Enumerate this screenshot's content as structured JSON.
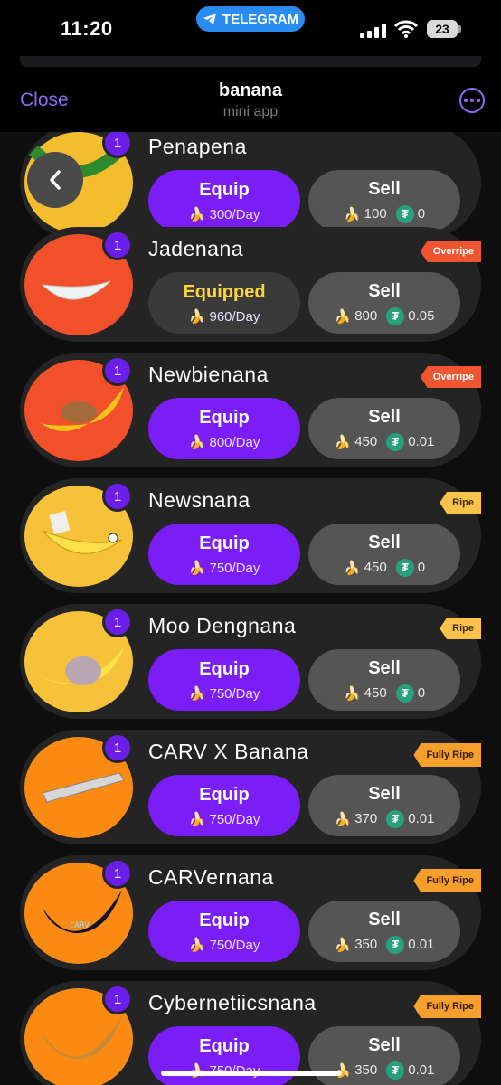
{
  "status": {
    "time": "11:20",
    "pill": "TELEGRAM",
    "battery": "23"
  },
  "header": {
    "close": "Close",
    "title": "banana",
    "subtitle": "mini app"
  },
  "colors": {
    "accent": "#7a1df6",
    "equipped_text": "#ffd43a",
    "overripe": "#ef5530",
    "ripe": "#ffc24a",
    "fully_ripe": "#f5a02c",
    "usdt": "#26a17b"
  },
  "items": [
    {
      "name": "Penapena",
      "qty": "1",
      "tag": "",
      "equip": "Equip",
      "rate": "300/Day",
      "sell": "Sell",
      "banana_price": "100",
      "usdt_price": "0"
    },
    {
      "name": "Jadenana",
      "qty": "1",
      "tag": "Overripe",
      "equip": "Equipped",
      "rate": "960/Day",
      "sell": "Sell",
      "banana_price": "800",
      "usdt_price": "0.05"
    },
    {
      "name": "Newbienana",
      "qty": "1",
      "tag": "Overripe",
      "equip": "Equip",
      "rate": "800/Day",
      "sell": "Sell",
      "banana_price": "450",
      "usdt_price": "0.01"
    },
    {
      "name": "Newsnana",
      "qty": "1",
      "tag": "Ripe",
      "equip": "Equip",
      "rate": "750/Day",
      "sell": "Sell",
      "banana_price": "450",
      "usdt_price": "0"
    },
    {
      "name": "Moo Dengnana",
      "qty": "1",
      "tag": "Ripe",
      "equip": "Equip",
      "rate": "750/Day",
      "sell": "Sell",
      "banana_price": "450",
      "usdt_price": "0"
    },
    {
      "name": "CARV X Banana",
      "qty": "1",
      "tag": "Fully Ripe",
      "equip": "Equip",
      "rate": "750/Day",
      "sell": "Sell",
      "banana_price": "370",
      "usdt_price": "0.01"
    },
    {
      "name": "CARVernana",
      "qty": "1",
      "tag": "Fully Ripe",
      "equip": "Equip",
      "rate": "750/Day",
      "sell": "Sell",
      "banana_price": "350",
      "usdt_price": "0.01"
    },
    {
      "name": "Cybernetiicsnana",
      "qty": "1",
      "tag": "Fully Ripe",
      "equip": "Equip",
      "rate": "750/Day",
      "sell": "Sell",
      "banana_price": "350",
      "usdt_price": "0.01"
    }
  ]
}
